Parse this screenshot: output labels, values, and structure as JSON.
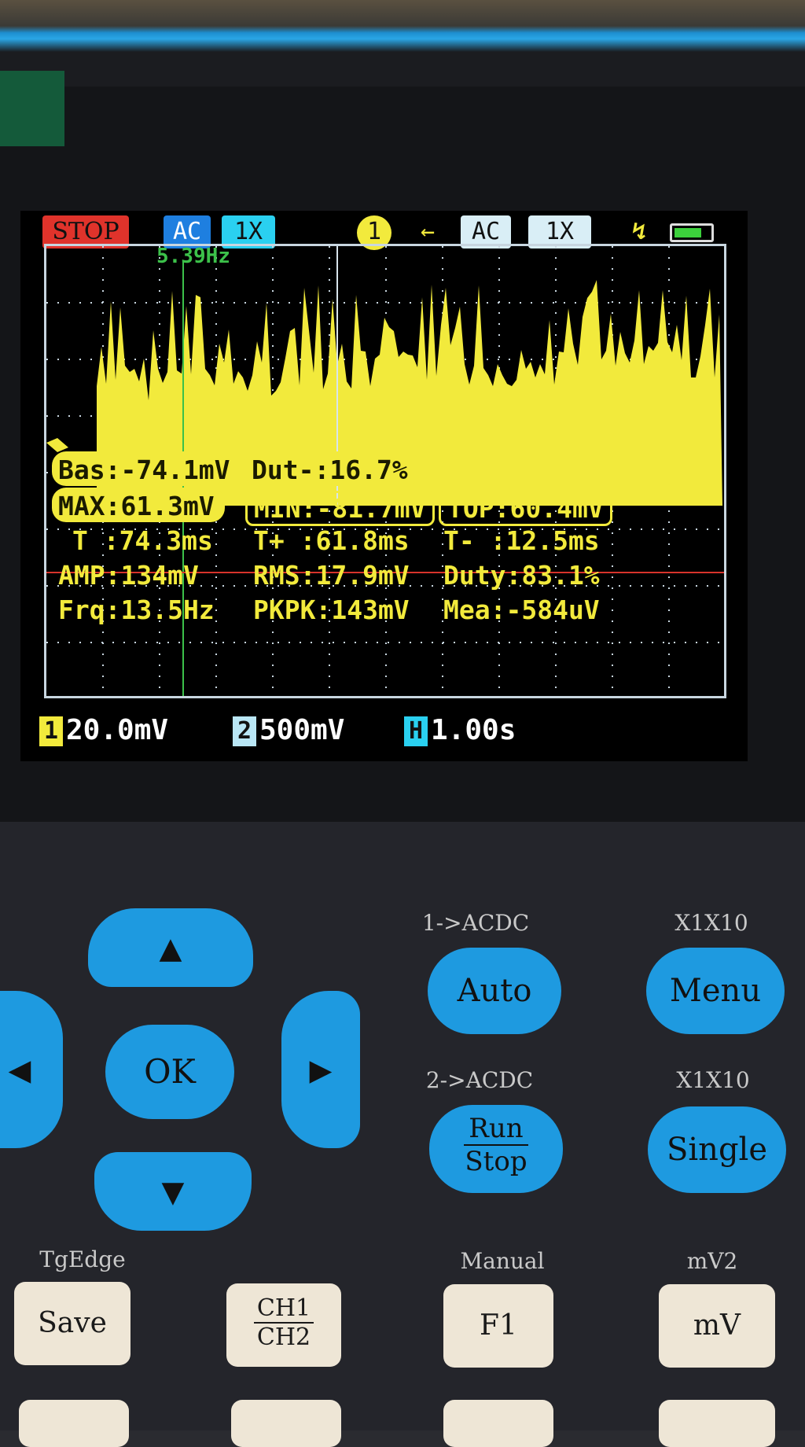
{
  "status": {
    "stop": "STOP",
    "ch1_coupling": "AC",
    "ch1_probe": "1X",
    "trigger_channel": "1",
    "ch2_coupling": "AC",
    "ch2_probe": "1X",
    "cursor_freq": "5.39Hz"
  },
  "measurements": {
    "bas": "Bas:-74.1mV",
    "dut_neg": "Dut-:16.7%",
    "max": "MAX:61.3mV",
    "min": "MIN:-81.7mV",
    "top": "TOP:60.4mV",
    "t": "T :74.3ms",
    "t_plus": "T+ :61.8ms",
    "t_minus": "T- :12.5ms",
    "amp": "AMP:134mV",
    "rms": "RMS:17.9mV",
    "duty": "Duty:83.1%",
    "frq": "Frq:13.5Hz",
    "pkpk": "PKPK:143mV",
    "mea": "Mea:-584uV"
  },
  "scale": {
    "ch1_label": "1",
    "ch1_value": "20.0mV",
    "ch2_label": "2",
    "ch2_value": "500mV",
    "time_label": "H",
    "time_value": "1.00s"
  },
  "buttons": {
    "ok": "OK",
    "auto": "Auto",
    "auto_label": "1->ACDC",
    "menu": "Menu",
    "menu_label": "X1X10",
    "run": "Run",
    "stop": "Stop",
    "run_label": "2->ACDC",
    "single": "Single",
    "single_label": "X1X10",
    "save": "Save",
    "save_label": "TgEdge",
    "ch1": "CH1",
    "ch2": "CH2",
    "f1": "F1",
    "f1_label": "Manual",
    "mv": "mV",
    "mv_label": "mV2"
  },
  "colors": {
    "trace": "#f2ea3c",
    "ch1_chip": "#f2ea3c",
    "ch2_chip": "#b9e6f5",
    "accent_blue": "#1e9ae0",
    "stop_red": "#e0332b"
  }
}
